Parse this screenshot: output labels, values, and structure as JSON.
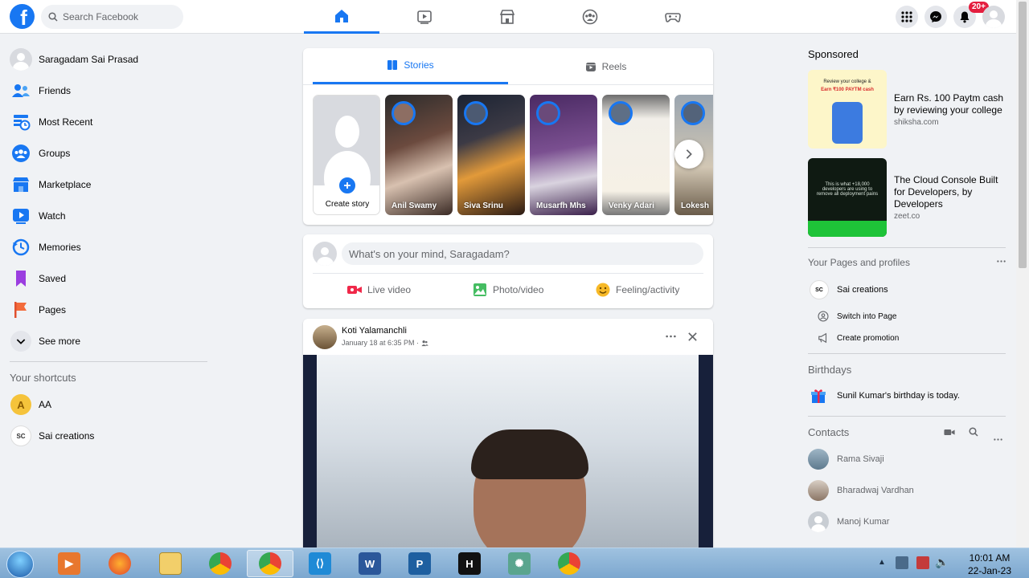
{
  "search": {
    "placeholder": "Search Facebook"
  },
  "notifications": {
    "badge": "20+"
  },
  "left_sidebar": {
    "items": [
      {
        "label": "Saragadam Sai Prasad",
        "icon": "profile-avatar"
      },
      {
        "label": "Friends",
        "icon": "friends-icon"
      },
      {
        "label": "Most Recent",
        "icon": "most-recent-icon"
      },
      {
        "label": "Groups",
        "icon": "groups-icon"
      },
      {
        "label": "Marketplace",
        "icon": "marketplace-icon"
      },
      {
        "label": "Watch",
        "icon": "watch-icon"
      },
      {
        "label": "Memories",
        "icon": "memories-icon"
      },
      {
        "label": "Saved",
        "icon": "saved-icon"
      },
      {
        "label": "Pages",
        "icon": "pages-icon"
      },
      {
        "label": "See more",
        "icon": "chevron-down-icon"
      }
    ],
    "shortcuts_title": "Your shortcuts",
    "shortcuts": [
      {
        "label": "AA",
        "initial": "A"
      },
      {
        "label": "Sai creations",
        "initial": "SC"
      }
    ]
  },
  "stories": {
    "tabs": [
      {
        "label": "Stories"
      },
      {
        "label": "Reels"
      }
    ],
    "create_label": "Create story",
    "items": [
      {
        "name": "Anil Swamy"
      },
      {
        "name": "Siva Srinu"
      },
      {
        "name": "Musarfh Mhs"
      },
      {
        "name": "Venky Adari"
      },
      {
        "name": "Lokesh L"
      }
    ]
  },
  "composer": {
    "placeholder": "What's on your mind, Saragadam?",
    "actions": [
      {
        "label": "Live video"
      },
      {
        "label": "Photo/video"
      },
      {
        "label": "Feeling/activity"
      }
    ]
  },
  "post": {
    "author": "Koti Yalamanchli",
    "timestamp": "January 18 at 6:35 PM ·"
  },
  "right_sidebar": {
    "sponsored_title": "Sponsored",
    "ads": [
      {
        "title": "Earn Rs. 100 Paytm cash by reviewing your college",
        "site": "shiksha.com",
        "img_text_1": "Review your college &",
        "img_text_2": "Earn ₹100 PAYTM cash"
      },
      {
        "title": "The Cloud Console Built for Developers, by Developers",
        "site": "zeet.co",
        "img_text_1": "This is what +18,000 developers are using to remove all deployment pains"
      }
    ],
    "pages_title": "Your Pages and profiles",
    "page_name": "Sai creations",
    "page_actions": [
      {
        "label": "Switch into Page"
      },
      {
        "label": "Create promotion"
      }
    ],
    "birthdays_title": "Birthdays",
    "birthday_text": "Sunil Kumar's birthday is today.",
    "contacts_title": "Contacts",
    "contacts": [
      {
        "name": "Rama Sivaji"
      },
      {
        "name": "Bharadwaj Vardhan"
      },
      {
        "name": "Manoj Kumar"
      }
    ]
  },
  "taskbar": {
    "time": "10:01 AM",
    "date": "22-Jan-23"
  }
}
